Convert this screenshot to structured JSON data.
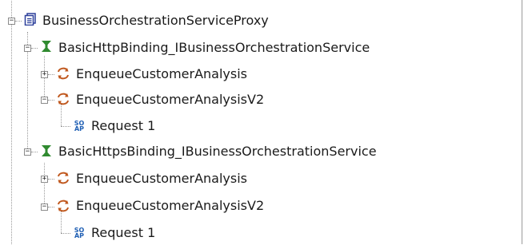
{
  "tree": {
    "root": {
      "label": "BusinessOrchestrationServiceProxy",
      "icon": "service-proxy-icon",
      "expanded": true
    },
    "bindings": [
      {
        "label": "BasicHttpBinding_IBusinessOrchestrationService",
        "icon": "binding-icon",
        "expanded": true,
        "operations": [
          {
            "label": "EnqueueCustomerAnalysis",
            "icon": "operation-icon",
            "expanded": false
          },
          {
            "label": "EnqueueCustomerAnalysisV2",
            "icon": "operation-icon",
            "expanded": true,
            "request": "Request 1"
          }
        ]
      },
      {
        "label": "BasicHttpsBinding_IBusinessOrchestrationService",
        "icon": "binding-icon",
        "expanded": true,
        "operations": [
          {
            "label": "EnqueueCustomerAnalysis",
            "icon": "operation-icon",
            "expanded": false
          },
          {
            "label": "EnqueueCustomerAnalysisV2",
            "icon": "operation-icon",
            "expanded": true,
            "request": "Request 1"
          }
        ]
      }
    ],
    "toggle_expanded": "−",
    "toggle_collapsed": "+",
    "soap_icon_text": "SO\nAP"
  },
  "colors": {
    "binding_icon": "#2f8a2f",
    "operation_icon": "#c0581e",
    "proxy_icon": "#2b3f9a",
    "soap_icon": "#1f5fb4"
  }
}
